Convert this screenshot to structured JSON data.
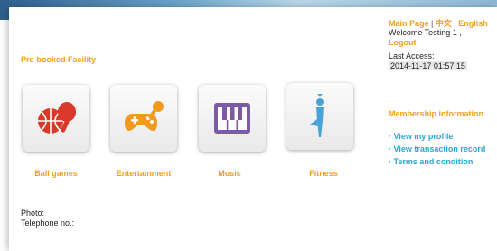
{
  "header": {
    "languages": [
      "Main Page",
      "中文",
      "English"
    ],
    "welcome": "Welcome Testing 1 ,",
    "logout": "Logout",
    "last_access_label": "Last Access:",
    "last_access_time": "2014-11-17 01:57:15"
  },
  "section_title": "Pre-booked Facility",
  "facilities": [
    {
      "label": "Ball games",
      "icon": "ball-games-icon",
      "color": "#d9382a"
    },
    {
      "label": "Entertainment",
      "icon": "game-controller-microphone-icon",
      "color": "#f29a1f"
    },
    {
      "label": "Music",
      "icon": "piano-keys-icon",
      "color": "#7b5aa6"
    },
    {
      "label": "Fitness",
      "icon": "yoga-figure-icon",
      "color": "#4aa3d8"
    }
  ],
  "info": {
    "photo_label": "Photo:",
    "telephone_label": "Telephone no.:"
  },
  "membership": {
    "title": "Membership information",
    "links": [
      "View my profile",
      "View transaction record",
      "Terms and condition"
    ]
  },
  "colors": {
    "accent": "#f0a020",
    "link": "#2aa8d6"
  }
}
